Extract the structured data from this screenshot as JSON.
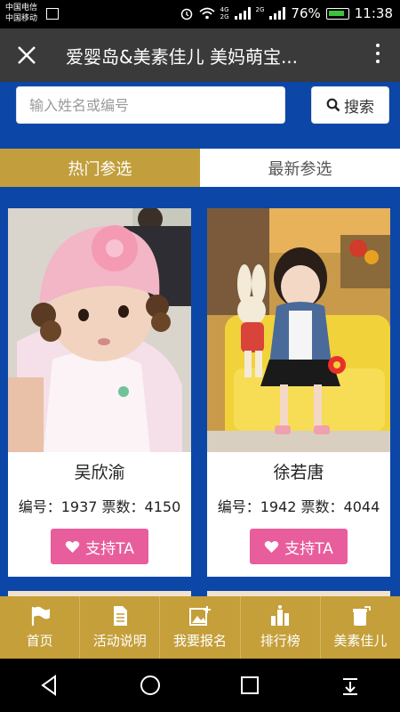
{
  "status_bar": {
    "carrier_1": "中国电信",
    "carrier_2": "中国移动",
    "net_1": "4G",
    "net_2": "2G",
    "net_3": "2G",
    "battery_percent": "76%",
    "time": "11:38"
  },
  "titlebar": {
    "title": "爱婴岛&美素佳儿 美妈萌宝...",
    "close_icon": "close-icon",
    "more_icon": "more-vertical-icon"
  },
  "search": {
    "placeholder": "输入姓名或编号",
    "button_label": "搜索",
    "icon": "search-icon"
  },
  "tabs": [
    {
      "label": "热门参选",
      "active": true
    },
    {
      "label": "最新参选",
      "active": false
    }
  ],
  "cards": [
    {
      "name": "吴欣渝",
      "stats": "编号：1937 票数：4150",
      "button_label": "支持TA",
      "button_icon": "heart-icon"
    },
    {
      "name": "徐若唐",
      "stats": "编号：1942 票数：4044",
      "button_label": "支持TA",
      "button_icon": "heart-icon"
    }
  ],
  "bottom_nav": [
    {
      "label": "首页",
      "icon": "flag-icon"
    },
    {
      "label": "活动说明",
      "icon": "document-icon"
    },
    {
      "label": "我要报名",
      "icon": "image-add-icon"
    },
    {
      "label": "排行榜",
      "icon": "ranking-icon"
    },
    {
      "label": "美素佳儿",
      "icon": "milk-can-icon"
    }
  ],
  "colors": {
    "page_background": "#0c47a8",
    "tab_active": "#c29e3c",
    "nav_background": "#c49f3a",
    "vote_button": "#e85d9c"
  }
}
